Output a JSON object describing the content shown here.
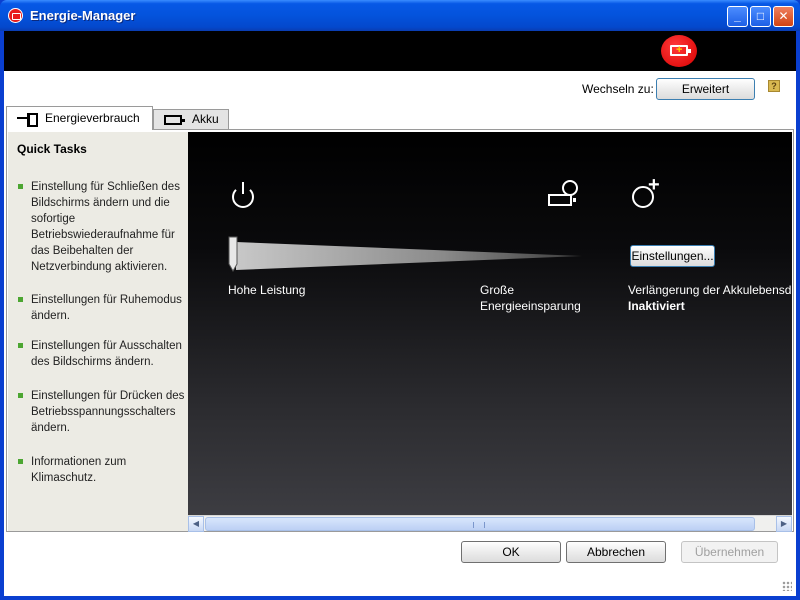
{
  "window": {
    "title": "Energie-Manager",
    "min_symbol": "_",
    "max_symbol": "□",
    "close_symbol": "✕"
  },
  "header": {
    "badge_icon": "battery-charging-icon",
    "badge_color": "#e01010",
    "switch_label": "Wechseln zu:",
    "advanced_button": "Erweitert",
    "help_symbol": "?"
  },
  "tabs": [
    {
      "label": "Energieverbrauch",
      "icon": "power-plug-icon",
      "active": true
    },
    {
      "label": "Akku",
      "icon": "battery-icon",
      "active": false
    }
  ],
  "quick_tasks": {
    "title": "Quick Tasks",
    "accent_color": "#4ca632",
    "items": [
      "Einstellung für Schließen des Bildschirms ändern und die sofortige Betriebswiederaufnahme für das Beibehalten der Netzverbindung aktivieren.",
      "Einstellungen für Ruhemodus ändern.",
      "Einstellungen für Ausschalten des Bildschirms ändern.",
      "Einstellungen für Drücken des Betriebsspannungsschalters ändern.",
      "Informationen zum Klimaschutz."
    ]
  },
  "main": {
    "slider_high_label": "Hohe Leistung",
    "slider_saving_label_1": "Große",
    "slider_saving_label_2": "Energieeinsparung",
    "extension_label": "Verlängerung der Akkulebensda",
    "extension_state": "Inaktiviert",
    "settings_button": "Einstellungen...",
    "icons": [
      "power-icon",
      "battery-clock-icon",
      "clock-plus-icon"
    ]
  },
  "footer": {
    "ok": "OK",
    "cancel": "Abbrechen",
    "apply": "Übernehmen"
  }
}
